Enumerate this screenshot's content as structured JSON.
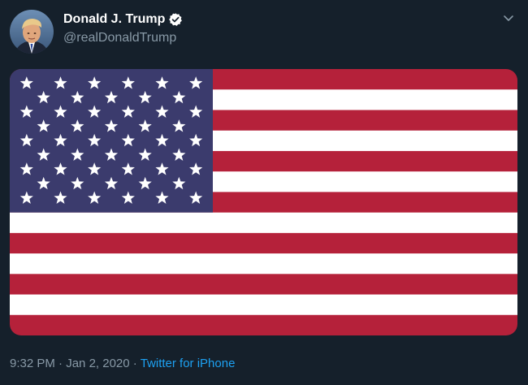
{
  "tweet": {
    "display_name": "Donald J. Trump",
    "handle": "@realDonaldTrump",
    "time": "9:32 PM",
    "separator": " · ",
    "date": "Jan 2, 2020",
    "source": "Twitter for iPhone"
  },
  "icons": {
    "verified": "verified-badge-icon",
    "caret": "chevron-down-icon"
  },
  "media": {
    "subject": "US flag image",
    "stripes": 13,
    "star_rows": 9,
    "colors": {
      "red": "#b5213a",
      "white": "#ffffff",
      "blue": "#3b3b6d"
    }
  },
  "colors": {
    "background": "#15202b",
    "primary_text": "#ffffff",
    "secondary_text": "#8899a6",
    "link": "#1da1f2"
  }
}
